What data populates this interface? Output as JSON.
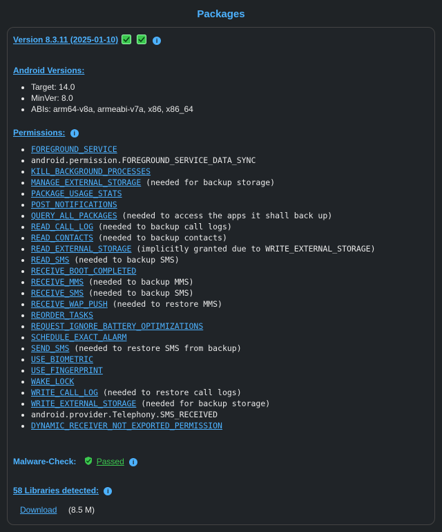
{
  "title": "Packages",
  "version": {
    "label": "Version 8.3.11 (2025-01-10)"
  },
  "android": {
    "heading": "Android Versions:",
    "target_label": "Target: 14.0",
    "minver_label": "MinVer: 8.0",
    "abis_label": "ABIs: arm64-v8a, armeabi-v7a, x86, x86_64"
  },
  "permissions": {
    "heading": "Permissions:",
    "items": [
      {
        "name": "FOREGROUND_SERVICE",
        "link": true,
        "note": ""
      },
      {
        "name": "android.permission.FOREGROUND_SERVICE_DATA_SYNC",
        "link": false,
        "note": ""
      },
      {
        "name": "KILL_BACKGROUND_PROCESSES",
        "link": true,
        "note": ""
      },
      {
        "name": "MANAGE_EXTERNAL_STORAGE",
        "link": true,
        "note": " (needed for backup storage)"
      },
      {
        "name": "PACKAGE_USAGE_STATS",
        "link": true,
        "note": ""
      },
      {
        "name": "POST_NOTIFICATIONS",
        "link": true,
        "note": ""
      },
      {
        "name": "QUERY_ALL_PACKAGES",
        "link": true,
        "note": " (needed to access the apps it shall back up)"
      },
      {
        "name": "READ_CALL_LOG",
        "link": true,
        "note": " (needed to backup call logs)"
      },
      {
        "name": "READ_CONTACTS",
        "link": true,
        "note": " (needed to backup contacts)"
      },
      {
        "name": "READ_EXTERNAL_STORAGE",
        "link": true,
        "note": " (implicitly granted due to WRITE_EXTERNAL_STORAGE)"
      },
      {
        "name": "READ_SMS",
        "link": true,
        "note": " (needed to backup SMS)"
      },
      {
        "name": "RECEIVE_BOOT_COMPLETED",
        "link": true,
        "note": ""
      },
      {
        "name": "RECEIVE_MMS",
        "link": true,
        "note": " (needed to backup MMS)"
      },
      {
        "name": "RECEIVE_SMS",
        "link": true,
        "note": " (needed to backup SMS)"
      },
      {
        "name": "RECEIVE_WAP_PUSH",
        "link": true,
        "note": " (needed to restore MMS)"
      },
      {
        "name": "REORDER_TASKS",
        "link": true,
        "note": ""
      },
      {
        "name": "REQUEST_IGNORE_BATTERY_OPTIMIZATIONS",
        "link": true,
        "note": ""
      },
      {
        "name": "SCHEDULE_EXACT_ALARM",
        "link": true,
        "note": ""
      },
      {
        "name": "SEND_SMS",
        "link": true,
        "note": " (needed to restore SMS from backup)"
      },
      {
        "name": "USE_BIOMETRIC",
        "link": true,
        "note": ""
      },
      {
        "name": "USE_FINGERPRINT",
        "link": true,
        "note": ""
      },
      {
        "name": "WAKE_LOCK",
        "link": true,
        "note": ""
      },
      {
        "name": "WRITE_CALL_LOG",
        "link": true,
        "note": " (needed to restore call logs)"
      },
      {
        "name": "WRITE_EXTERNAL_STORAGE",
        "link": true,
        "note": " (needed for backup storage)"
      },
      {
        "name": "android.provider.Telephony.SMS_RECEIVED",
        "link": false,
        "note": ""
      },
      {
        "name": "DYNAMIC_RECEIVER_NOT_EXPORTED_PERMISSION",
        "link": true,
        "note": ""
      }
    ]
  },
  "malware": {
    "label": "Malware-Check:",
    "status": "Passed"
  },
  "libraries": {
    "label": "58 Libraries detected:"
  },
  "download": {
    "label": "Download",
    "size": "(8.5 M)"
  }
}
